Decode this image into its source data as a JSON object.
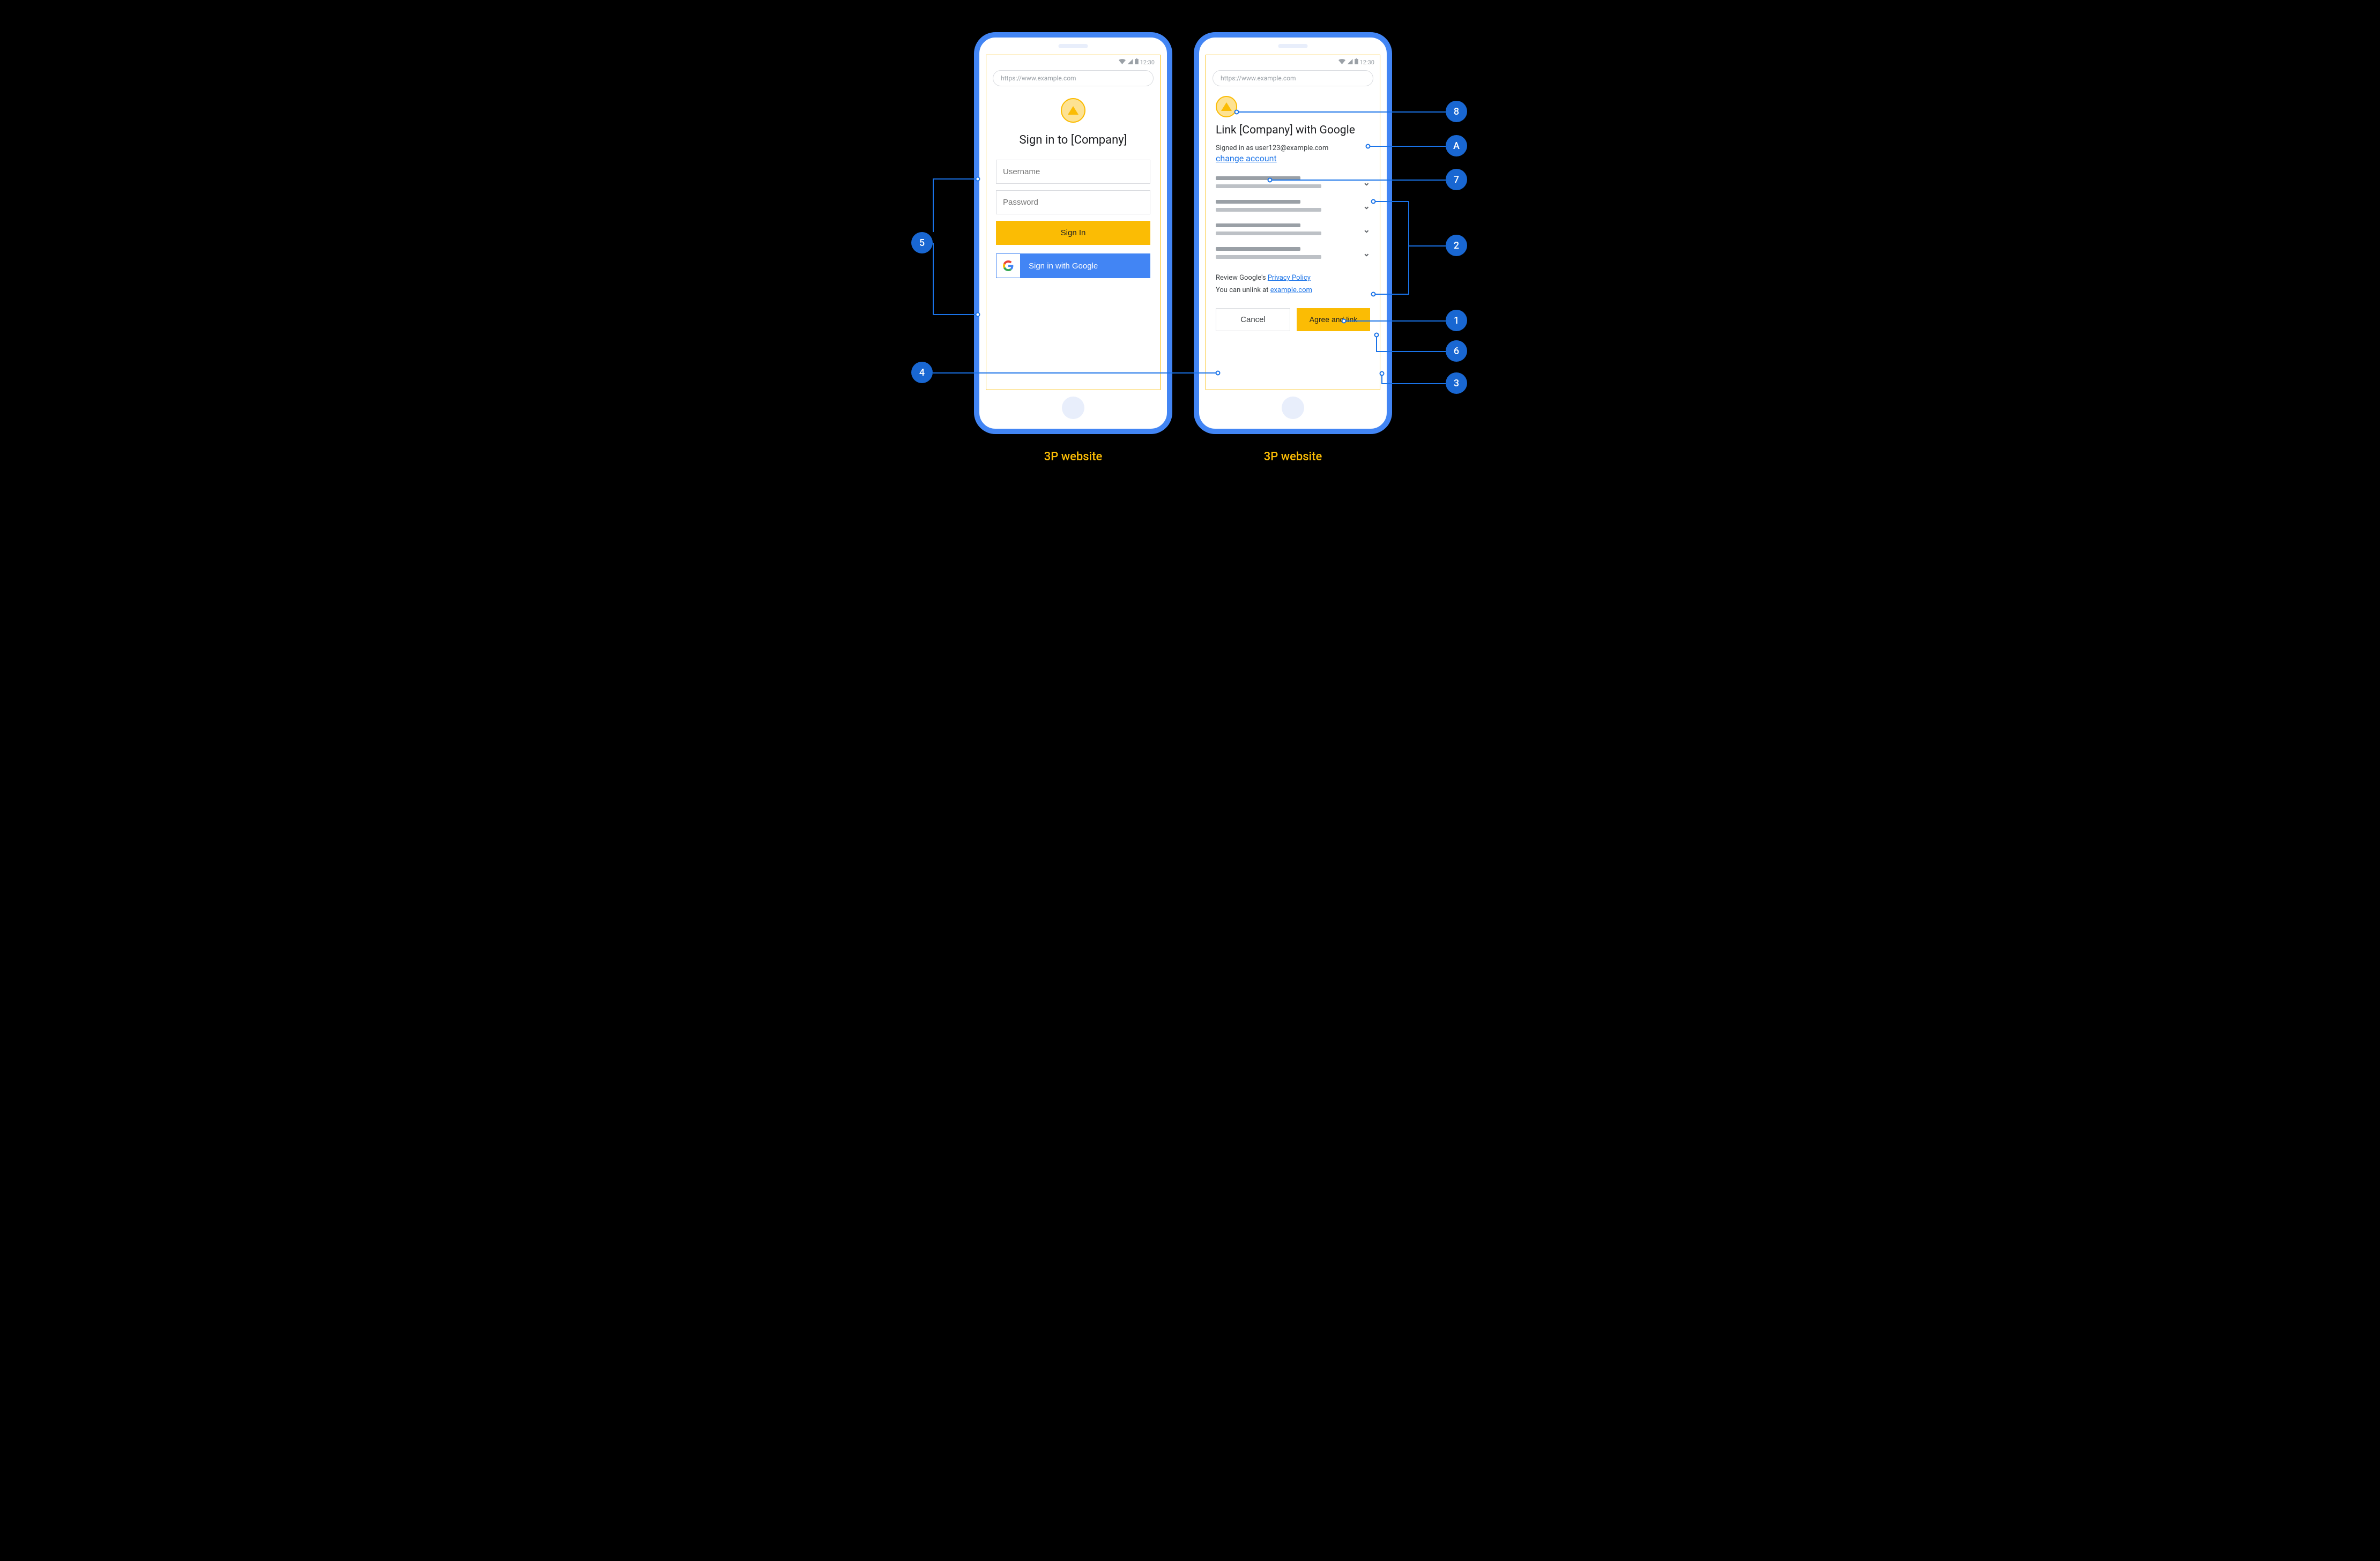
{
  "status": {
    "time": "12:30"
  },
  "url": "https://www.example.com",
  "signin": {
    "title": "Sign in to [Company]",
    "username_ph": "Username",
    "password_ph": "Password",
    "signin_btn": "Sign In",
    "google_btn": "Sign in with Google"
  },
  "consent": {
    "title": "Link [Company] with Google",
    "signed_in": "Signed in as user123@example.com",
    "change_account": "change account",
    "review_prefix": "Review Google's ",
    "privacy": "Privacy Policy",
    "unlink_prefix": "You can unlink at ",
    "unlink_link": "example.com",
    "cancel": "Cancel",
    "agree": "Agree and link"
  },
  "captions": {
    "left": "3P website",
    "right": "3P website"
  },
  "callouts": {
    "c5": "5",
    "c4": "4",
    "c8": "8",
    "cA": "A",
    "c7": "7",
    "c2": "2",
    "c1": "1",
    "c6": "6",
    "c3": "3"
  }
}
